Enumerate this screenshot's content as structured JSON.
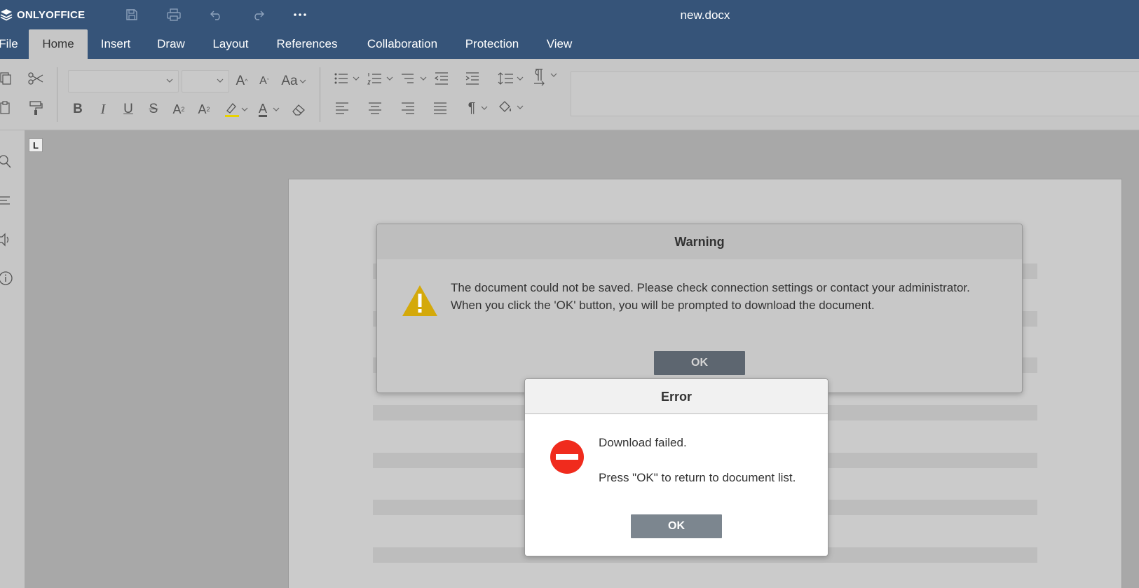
{
  "header": {
    "logo_text": "ONLYOFFICE",
    "doc_title": "new.docx",
    "quick_access": [
      "save-icon",
      "print-icon",
      "undo-icon",
      "redo-icon",
      "more-icon"
    ]
  },
  "tabs": [
    {
      "label": "File"
    },
    {
      "label": "Home",
      "active": true
    },
    {
      "label": "Insert"
    },
    {
      "label": "Draw"
    },
    {
      "label": "Layout"
    },
    {
      "label": "References"
    },
    {
      "label": "Collaboration"
    },
    {
      "label": "Protection"
    },
    {
      "label": "View"
    }
  ],
  "toolbar": {
    "increase_font_glyph": "A",
    "decrease_font_glyph": "A",
    "change_case_glyph": "Aa",
    "bold_glyph": "B",
    "italic_glyph": "I",
    "underline_glyph": "U",
    "strike_glyph": "S",
    "superscript_glyph": "A",
    "superscript_mark": "2",
    "subscript_glyph": "A",
    "subscript_mark": "2",
    "font_color_glyph": "A",
    "highlight_color": "#e8d200",
    "paragraph_mark_glyph": "¶"
  },
  "left_panel": [
    "search-icon",
    "navigation-icon",
    "speech-icon",
    "info-icon"
  ],
  "ruler_tab_glyph": "L",
  "warning_dialog": {
    "title": "Warning",
    "message_line1": "The document could not be saved. Please check connection settings or contact your administrator.",
    "message_line2": "When you click the 'OK' button, you will be prompted to download the document.",
    "button": "OK",
    "icon": "warning-triangle-icon",
    "icon_color": "#d4a90a"
  },
  "error_dialog": {
    "title": "Error",
    "message_line1": "Download failed.",
    "message_line2": "Press \"OK\" to return to document list.",
    "button": "OK",
    "icon": "error-no-entry-icon",
    "icon_color": "#f02b1d"
  },
  "colors": {
    "header_bg": "#365479",
    "toolbar_bg": "#c6c6c6",
    "workspace_bg": "#a8a8a8"
  }
}
